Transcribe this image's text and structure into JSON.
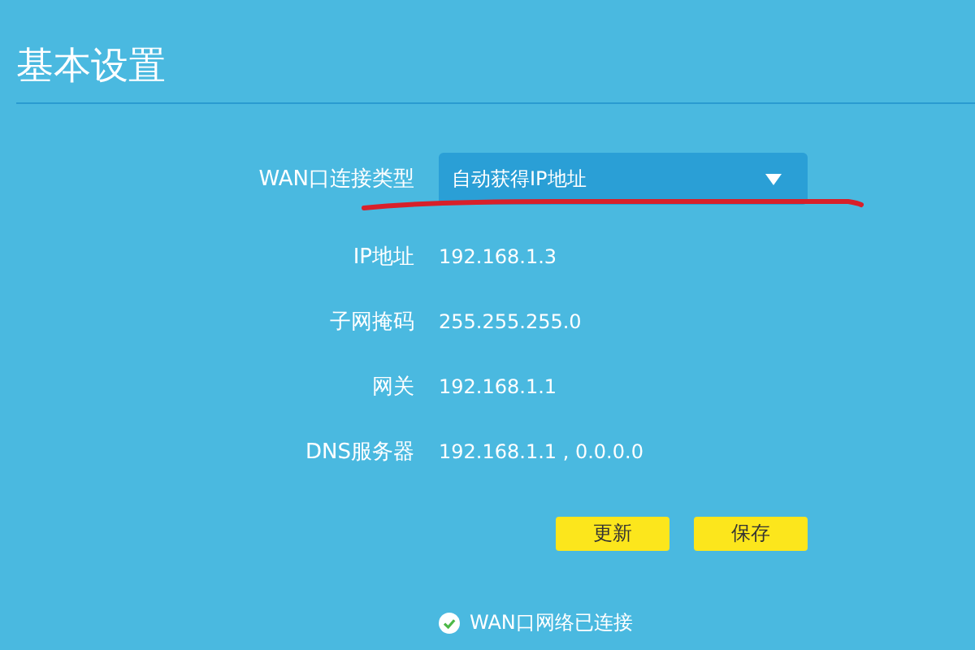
{
  "title": "基本设置",
  "wan_type": {
    "label": "WAN口连接类型",
    "value": "自动获得IP地址"
  },
  "fields": [
    {
      "label": "IP地址",
      "value": "192.168.1.3"
    },
    {
      "label": "子网掩码",
      "value": "255.255.255.0"
    },
    {
      "label": "网关",
      "value": "192.168.1.1"
    },
    {
      "label": "DNS服务器",
      "value": "192.168.1.1 , 0.0.0.0"
    }
  ],
  "buttons": [
    "更新",
    "保存"
  ],
  "status": {
    "text": "WAN口网络已连接",
    "connected": true
  }
}
